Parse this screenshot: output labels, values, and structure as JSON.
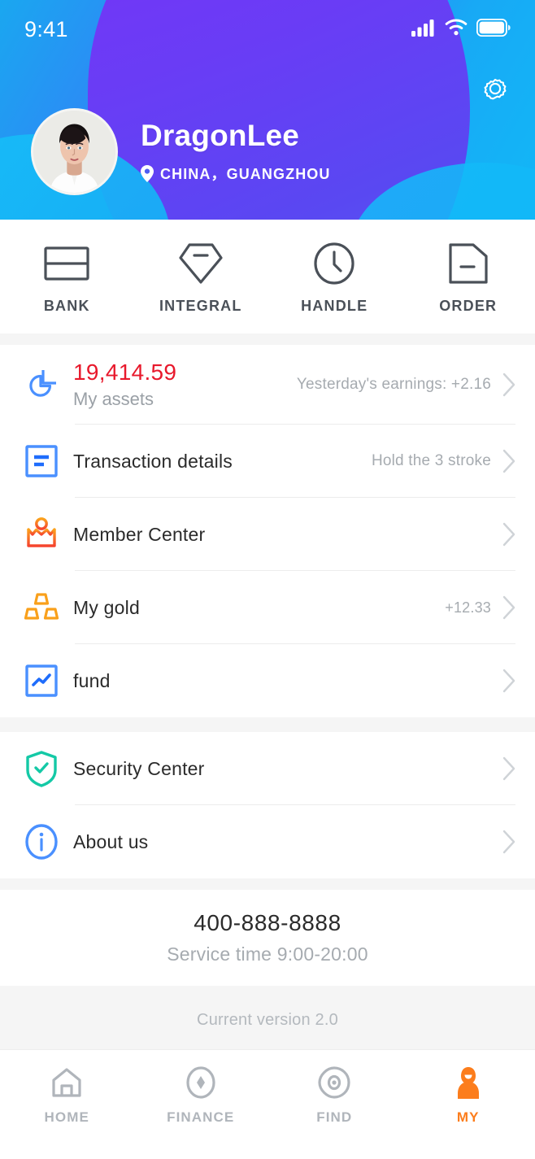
{
  "status_bar": {
    "time": "9:41",
    "icons": [
      "signal-icon",
      "wifi-icon",
      "battery-icon"
    ]
  },
  "header": {
    "settings_icon": "gear-icon",
    "avatar_alt": "user-avatar",
    "username": "DragonLee",
    "location": "CHINA，GUANGZHOU",
    "location_icon": "map-pin-icon",
    "colors": {
      "blue_start": "#1aa7f0",
      "blue_end": "#12b7f7",
      "purple_start": "#7b2ff7",
      "purple_end": "#5b63f0"
    }
  },
  "quick_actions": [
    {
      "label": "BANK",
      "icon": "bank-card-icon"
    },
    {
      "label": "INTEGRAL",
      "icon": "diamond-icon"
    },
    {
      "label": "HANDLE",
      "icon": "clock-icon"
    },
    {
      "label": "ORDER",
      "icon": "document-icon"
    }
  ],
  "assets": {
    "icon": "pie-chart-icon",
    "amount": "19,414.59",
    "amount_color": "#e8192c",
    "label": "My assets",
    "meta": "Yesterday's earnings: +2.16"
  },
  "menu_group_1": [
    {
      "label": "Transaction details",
      "icon": "transaction-list-icon",
      "icon_color": "#4a90ff",
      "meta": "Hold the 3 stroke"
    },
    {
      "label": "Member Center",
      "icon": "crown-icon",
      "icon_color": "#f96a3a",
      "meta": ""
    },
    {
      "label": "My gold",
      "icon": "gold-bars-icon",
      "icon_color": "#f9a01b",
      "meta": "+12.33"
    },
    {
      "label": "fund",
      "icon": "trend-chart-icon",
      "icon_color": "#4a90ff",
      "meta": ""
    }
  ],
  "menu_group_2": [
    {
      "label": "Security Center",
      "icon": "shield-check-icon",
      "icon_color": "#14c9a6",
      "meta": ""
    },
    {
      "label": "About us",
      "icon": "info-circle-icon",
      "icon_color": "#4a90ff",
      "meta": ""
    }
  ],
  "service": {
    "phone": "400-888-8888",
    "time": "Service time 9:00-20:00"
  },
  "version": {
    "text": "Current version 2.0"
  },
  "tabbar": {
    "active_color": "#fc7d1c",
    "inactive_color": "#b0b5bb",
    "items": [
      {
        "label": "HOME",
        "icon": "home-icon",
        "active": false
      },
      {
        "label": "FINANCE",
        "icon": "finance-diamond-icon",
        "active": false
      },
      {
        "label": "FIND",
        "icon": "find-eye-icon",
        "active": false
      },
      {
        "label": "MY",
        "icon": "user-icon",
        "active": true
      }
    ]
  }
}
